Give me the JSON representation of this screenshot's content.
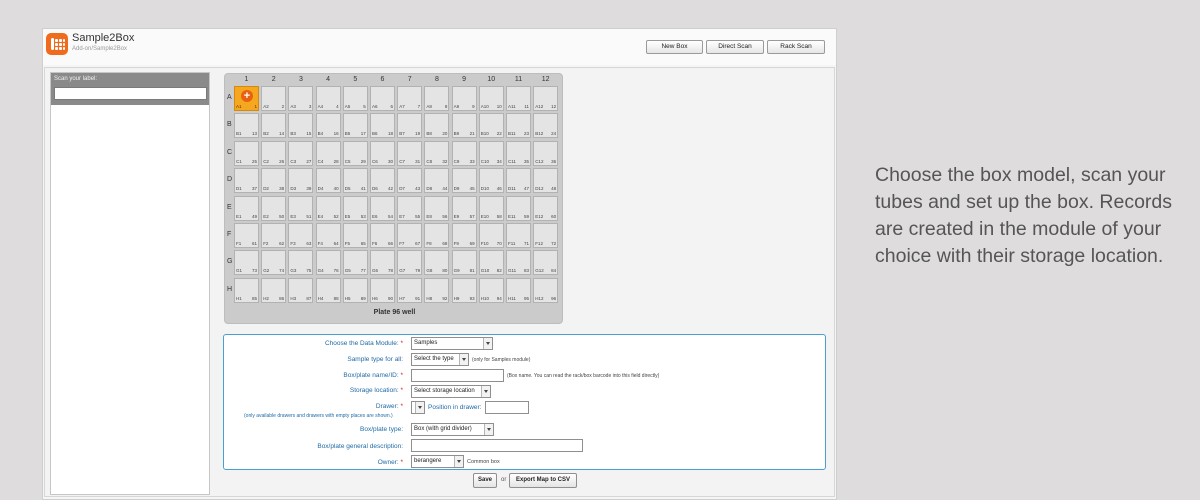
{
  "app": {
    "title": "Sample2Box",
    "subtitle": "Add-on/Sample2Box"
  },
  "toolbar": {
    "new_box": "New Box",
    "direct_scan": "Direct Scan",
    "rack_scan": "Rack Scan"
  },
  "sidebar": {
    "scan_label": "Scan your label:",
    "scan_value": ""
  },
  "plate": {
    "title": "Plate 96 well",
    "columns": [
      "1",
      "2",
      "3",
      "4",
      "5",
      "6",
      "7",
      "8",
      "9",
      "10",
      "11",
      "12"
    ],
    "rows": [
      "A",
      "B",
      "C",
      "D",
      "E",
      "F",
      "G",
      "H"
    ],
    "selected_well": "A1",
    "add_symbol": "+"
  },
  "form": {
    "data_module_label": "Choose the Data Module:",
    "data_module_value": "Samples",
    "sample_type_label": "Sample type for all:",
    "sample_type_value": "Select the type",
    "sample_type_hint": "(only for Samples module)",
    "box_name_label": "Box/plate name/ID:",
    "box_name_value": "",
    "box_name_hint": "(Box name. You can read the rack/box barcode into this field directly)",
    "storage_label": "Storage location:",
    "storage_value": "Select storage location",
    "drawer_label": "Drawer:",
    "drawer_hint": "(only available drawers and drawers with empty places are shown.)",
    "position_label": "Position in drawer:",
    "position_value": "",
    "box_type_label": "Box/plate type:",
    "box_type_value": "Box (with grid divider)",
    "description_label": "Box/plate general description:",
    "description_value": "",
    "owner_label": "Owner:",
    "owner_value": "berangere",
    "owner_note": "Common box",
    "required_mark": "*"
  },
  "actions": {
    "save": "Save",
    "or": "or",
    "export": "Export Map to CSV"
  },
  "caption": {
    "text": "Choose the box model, scan your tubes and set up the box. Records are created in the module of your choice with their storage location."
  },
  "colors": {
    "accent": "#ef6b1d",
    "selected_well": "#f5a81f",
    "form_border": "#4a9fd2",
    "label_blue": "#1f6aa5"
  }
}
